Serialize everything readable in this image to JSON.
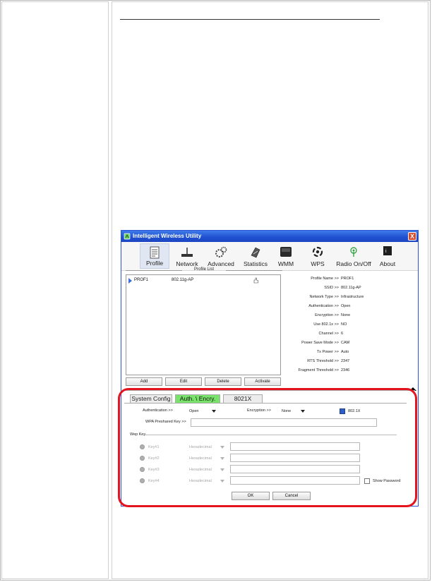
{
  "window": {
    "title": "Intelligent Wireless Utility",
    "close": "X"
  },
  "toolbar": [
    {
      "label": "Profile",
      "icon": "profile-icon"
    },
    {
      "label": "Network",
      "icon": "network-icon"
    },
    {
      "label": "Advanced",
      "icon": "advanced-icon"
    },
    {
      "label": "Statistics",
      "icon": "statistics-icon"
    },
    {
      "label": "WMM",
      "icon": "wmm-icon"
    },
    {
      "label": "WPS",
      "icon": "wps-icon"
    },
    {
      "label": "Radio On/Off",
      "icon": "radio-icon"
    },
    {
      "label": "About",
      "icon": "about-icon"
    }
  ],
  "profile_list": {
    "header": "Profile List",
    "rows": [
      {
        "name": "PROF1",
        "ssid": "802.11g-AP"
      }
    ],
    "buttons": {
      "add": "Add",
      "edit": "Edit",
      "delete": "Delete",
      "activate": "Activate"
    }
  },
  "info": [
    {
      "key": "Profile Name >>",
      "value": "PROF1"
    },
    {
      "key": "SSID >>",
      "value": "802.11g-AP"
    },
    {
      "key": "Network Type >>",
      "value": "Infrastructure"
    },
    {
      "key": "Authentication >>",
      "value": "Open"
    },
    {
      "key": "Encryption >>",
      "value": "None"
    },
    {
      "key": "Use 802.1x >>",
      "value": "NO"
    },
    {
      "key": "Channel >>",
      "value": "6"
    },
    {
      "key": "Power Save Mode >>",
      "value": "CAM"
    },
    {
      "key": "Tx Power >>",
      "value": "Auto"
    },
    {
      "key": "RTS Threshold >>",
      "value": "2347"
    },
    {
      "key": "Fragment Threshold >>",
      "value": "2346"
    }
  ],
  "tabs": {
    "system_config": "System Config",
    "auth_encry": "Auth. \\ Encry.",
    "8021x": "8021X"
  },
  "auth": {
    "authentication_label": "Authentication >>",
    "authentication_value": "Open",
    "encryption_label": "Encryption >>",
    "encryption_value": "None",
    "dot1x_label": "802.1X",
    "wpa_label": "WPA Preshared Key >>",
    "wpa_value": ""
  },
  "wep": {
    "header": "Wep Key",
    "keys": [
      {
        "label": "Key#1",
        "format": "Hexadecimal",
        "value": ""
      },
      {
        "label": "Key#2",
        "format": "Hexadecimal",
        "value": ""
      },
      {
        "label": "Key#3",
        "format": "Hexadecimal",
        "value": ""
      },
      {
        "label": "Key#4",
        "format": "Hexadecimal",
        "value": ""
      }
    ],
    "show_password": "Show Password"
  },
  "actions": {
    "ok": "OK",
    "cancel": "Cancel"
  },
  "colors": {
    "titlebar": "#1f4fd0",
    "active_tab": "#79e26a",
    "highlight": "#e4141e"
  }
}
